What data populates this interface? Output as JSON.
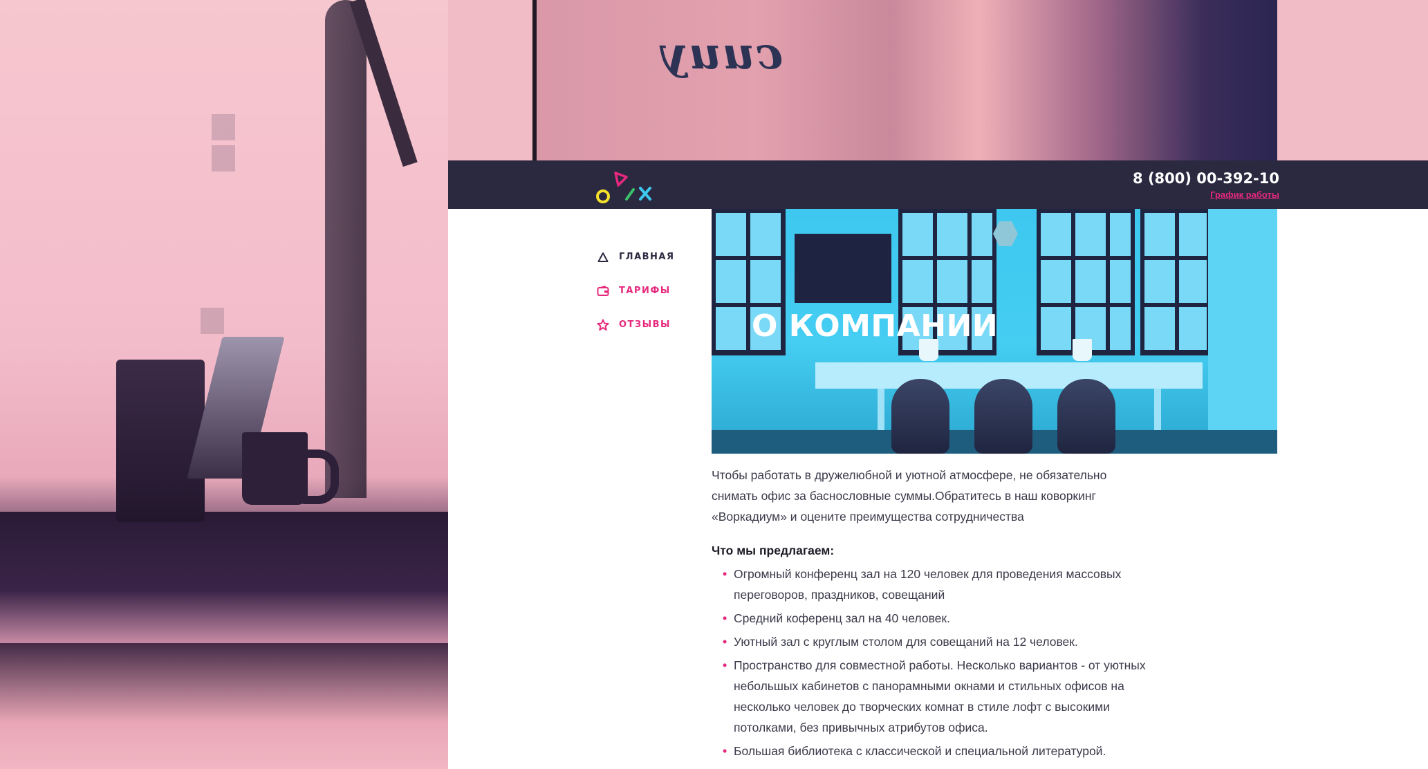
{
  "header": {
    "phone": "8 (800) 00-392-10",
    "schedule_link": "График работы"
  },
  "nav": {
    "items": [
      {
        "label": "ГЛАВНАЯ",
        "icon": "triangle-icon"
      },
      {
        "label": "ТАРИФЫ",
        "icon": "wallet-icon"
      },
      {
        "label": "ОТЗЫВЫ",
        "icon": "star-icon"
      }
    ]
  },
  "banner": {
    "title": "О КОМПАНИИ"
  },
  "content": {
    "intro": "Чтобы работать в дружелюбной и уютной атмосфере, не обязательно снимать офис за баснословные суммы.Обратитесь в наш коворкинг «Воркадиум» и оцените преимущества сотрудничества",
    "offer_heading": "Что мы предлагаем:",
    "offers": [
      "Огромный конференц зал на 120 человек для проведения массовых переговоров, праздников, совещаний",
      "Средний коференц зал на 40 человек.",
      "Уютный зал с круглым столом для совещаний на 12 человек.",
      "Пространство для совместной работы. Несколько вариантов - от уютных небольшых кабинетов с панорамными окнами и стильных офисов на несколько человек до творческих комнат в стиле лофт с высокими потолками, без привычных атрибутов офиса.",
      "Большая библиотека с классической и специальной литературой."
    ]
  },
  "colors": {
    "header_bg": "#2b2940",
    "accent_pink": "#e6297d",
    "banner_blue": "#45cdf2"
  }
}
